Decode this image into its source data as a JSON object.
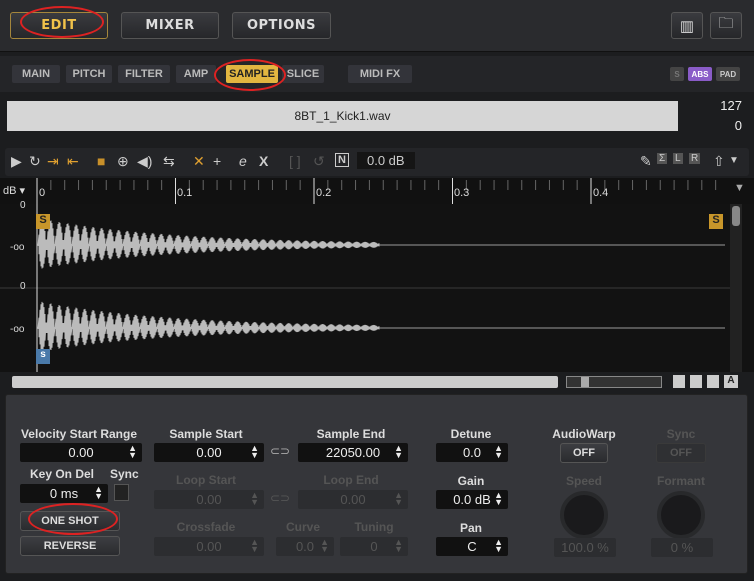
{
  "top": {
    "edit": "EDIT",
    "mixer": "MIXER",
    "options": "OPTIONS",
    "keyboard_icon": "piano-icon",
    "folder_icon": "folder-icon"
  },
  "tabs": [
    "MAIN",
    "PITCH",
    "FILTER",
    "AMP",
    "SAMPLE",
    "SLICE",
    "MIDI FX"
  ],
  "tab_flags": {
    "s": "S",
    "abs": "ABS",
    "pad": "PAD"
  },
  "sample": {
    "filename": "8BT_1_Kick1.wav",
    "vel_high": "127",
    "vel_low": "0"
  },
  "toolbar": {
    "gain": "0.0 dB",
    "n": "N",
    "sigma": "Σ",
    "l": "L",
    "r": "R"
  },
  "ruler": {
    "unit": "dB",
    "ticks": [
      "0",
      "0.1",
      "0.2",
      "0.3",
      "0.4"
    ]
  },
  "wave": {
    "start_marker": "S",
    "end_marker": "S",
    "slice_marker": "s",
    "db_top": "0",
    "db_inf": "-oo",
    "db_mid": "0"
  },
  "scroll": {
    "a": "A"
  },
  "params": {
    "vel_start_label": "Velocity Start Range",
    "vel_start": "0.00",
    "key_on_del_label": "Key On Del",
    "key_on_del": "0 ms",
    "sync_label": "Sync",
    "one_shot": "ONE SHOT",
    "reverse": "REVERSE",
    "sample_start_label": "Sample Start",
    "sample_start": "0.00",
    "sample_end_label": "Sample End",
    "sample_end": "22050.00",
    "loop_start_label": "Loop Start",
    "loop_start": "0.00",
    "loop_end_label": "Loop End",
    "loop_end": "0.00",
    "crossfade_label": "Crossfade",
    "crossfade": "0.00",
    "curve_label": "Curve",
    "curve": "0.0",
    "tuning_label": "Tuning",
    "tuning": "0",
    "detune_label": "Detune",
    "detune": "0.0",
    "gain_label": "Gain",
    "gain": "0.0 dB",
    "pan_label": "Pan",
    "pan": "C",
    "audiowarp_label": "AudioWarp",
    "audiowarp": "OFF",
    "warp_sync_label": "Sync",
    "warp_sync": "OFF",
    "speed_label": "Speed",
    "speed": "100.0 %",
    "formant_label": "Formant",
    "formant": "0 %"
  }
}
